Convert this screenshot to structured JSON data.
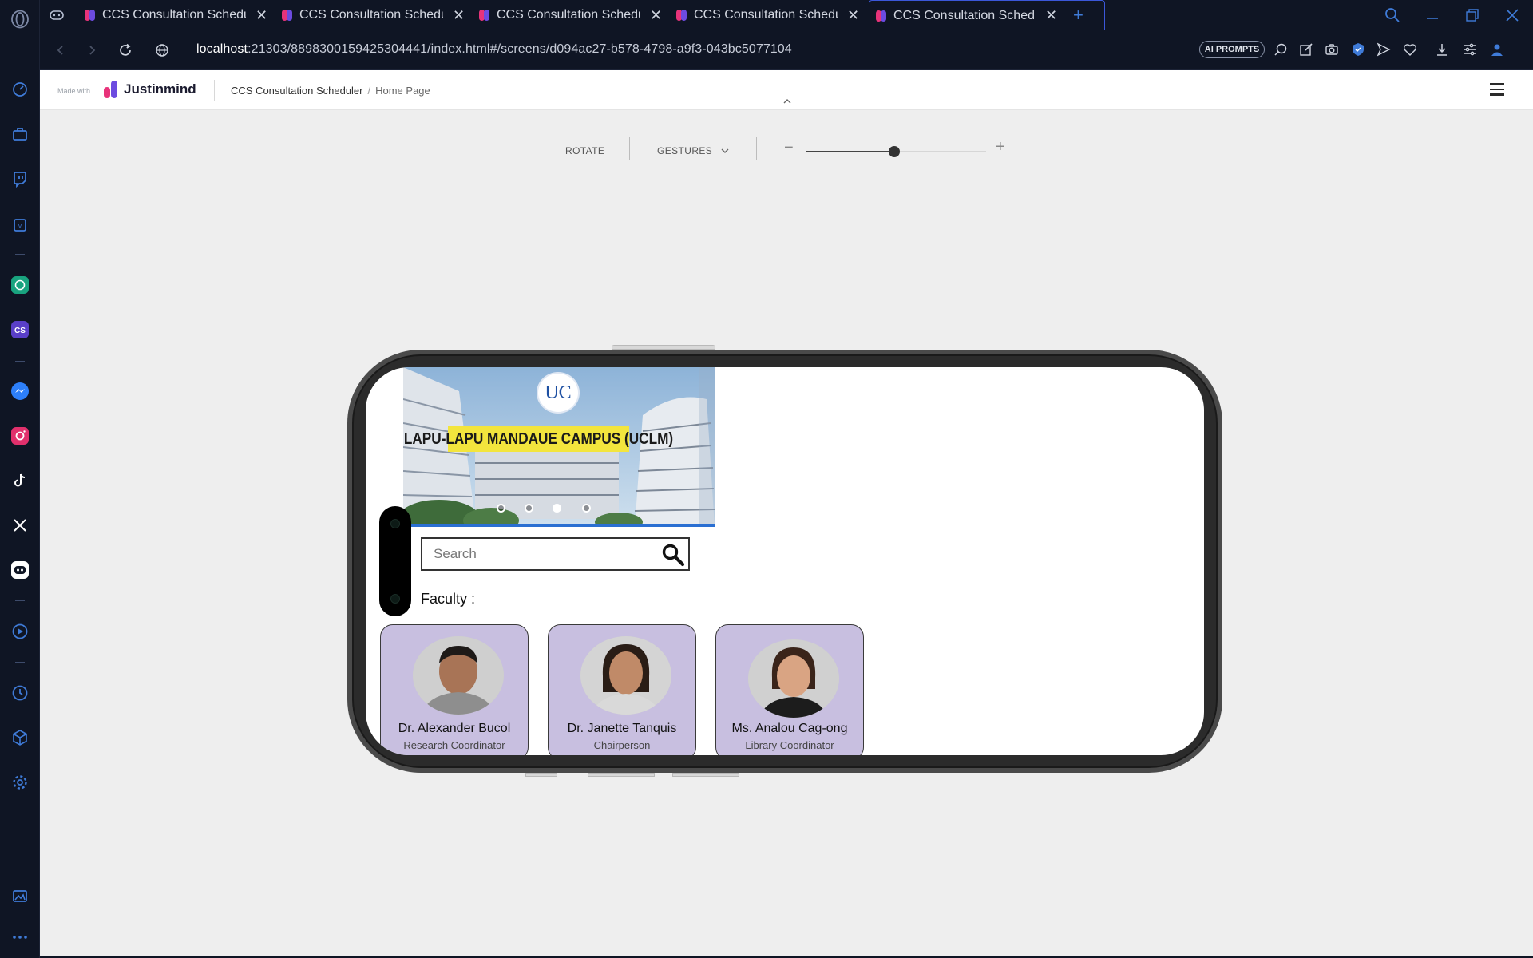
{
  "browser": {
    "tabs": [
      {
        "title": "CCS Consultation Scheduler",
        "active": false
      },
      {
        "title": "CCS Consultation Scheduler",
        "active": false
      },
      {
        "title": "CCS Consultation Scheduler",
        "active": false
      },
      {
        "title": "CCS Consultation Scheduler",
        "active": false
      },
      {
        "title": "CCS Consultation Scheduler",
        "active": true
      }
    ],
    "url_host": "localhost",
    "url_rest": ":21303/8898300159425304441/index.html#/screens/d094ac27-b578-4798-a9f3-043bc5077104",
    "ai_prompts_label": "AI PROMPTS",
    "new_tab_icon": "plus-icon"
  },
  "sidebar": {
    "icons": [
      "opera-logo-icon",
      "gaming-icon",
      "speed-dial-icon",
      "briefcase-icon",
      "twitch-icon",
      "ai-chip-icon",
      "chatgpt-icon",
      "cs-app-icon",
      "messenger-icon",
      "instagram-icon",
      "tiktok-icon",
      "x-icon",
      "discord-icon",
      "player-icon",
      "history-icon",
      "cube-icon",
      "settings-icon",
      "gallery-icon",
      "more-icon"
    ]
  },
  "header": {
    "made_with": "Made with",
    "logo_text": "Justinmind",
    "breadcrumb_project": "CCS Consultation Scheduler",
    "breadcrumb_sep": "/",
    "breadcrumb_page": "Home Page"
  },
  "simulator": {
    "rotate_label": "ROTATE",
    "gestures_label": "GESTURES",
    "zoom_minus": "−",
    "zoom_plus": "+",
    "zoom_level": 0.49
  },
  "app": {
    "banner_logo": "UC",
    "banner_text": "LAPU-LAPU MANDAUE CAMPUS (UCLM)",
    "carousel_dots": 4,
    "carousel_active": 2,
    "search_placeholder": "Search",
    "faculty_label": "Faculty :",
    "faculty": [
      {
        "name": "Dr. Alexander Bucol",
        "role": "Research Coordinator",
        "gender": "male"
      },
      {
        "name": "Dr. Janette Tanquis",
        "role": "Chairperson",
        "gender": "female"
      },
      {
        "name": "Ms. Analou Cag-ong",
        "role": "Library Coordinator",
        "gender": "female"
      }
    ]
  },
  "colors": {
    "card_bg": "#c8bfe0",
    "browser_bg": "#0f1524",
    "accent": "#3b57d9",
    "banner_yellow": "#f3e53d"
  }
}
